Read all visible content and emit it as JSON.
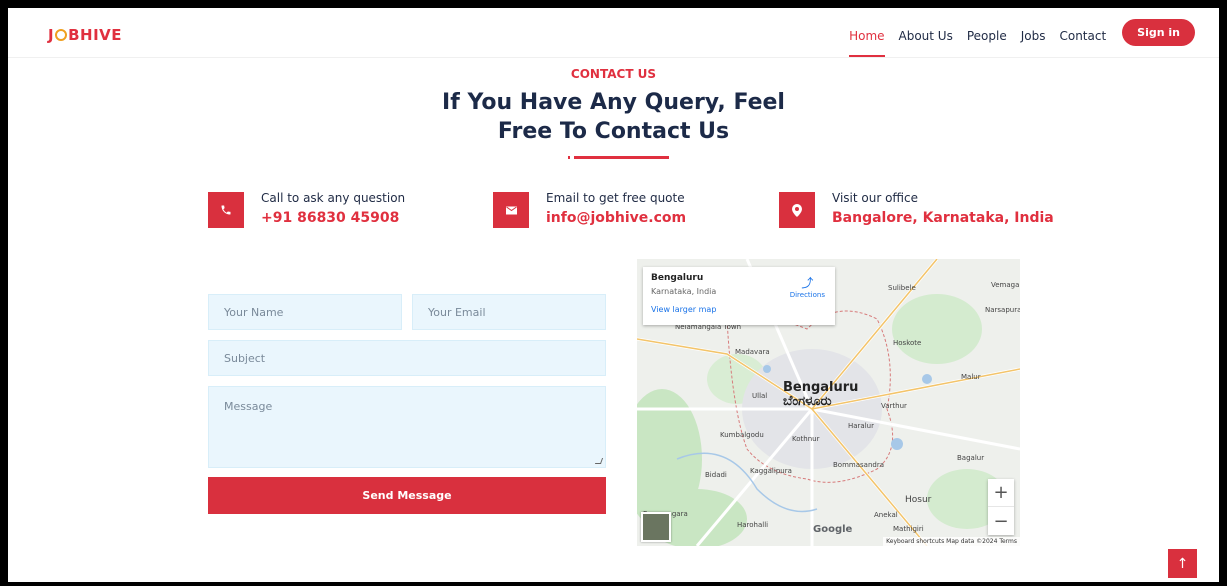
{
  "nav": {
    "logo": "JOBHIVE",
    "logo_left": "J",
    "logo_right": "BHIVE",
    "links": [
      "Home",
      "About Us",
      "People",
      "Jobs",
      "Contact"
    ],
    "signin": "Sign in"
  },
  "header": {
    "eyebrow": "CONTACT US",
    "title_line1": "If You Have Any Query, Feel",
    "title_line2": "Free To Contact Us"
  },
  "info": [
    {
      "label": "Call to ask any question",
      "value": "+91 86830 45908",
      "icon": "phone-icon"
    },
    {
      "label": "Email to get free quote",
      "value": "info@jobhive.com",
      "icon": "envelope-icon"
    },
    {
      "label": "Visit our office",
      "value": "Bangalore, Karnataka, India",
      "icon": "map-pin-icon"
    }
  ],
  "form": {
    "name_placeholder": "Your Name",
    "email_placeholder": "Your Email",
    "subject_placeholder": "Subject",
    "message_placeholder": "Message",
    "submit": "Send Message"
  },
  "map": {
    "place": "Bengaluru",
    "region": "Karnataka, India",
    "larger_map": "View larger map",
    "directions": "Directions",
    "city_en": "Bengaluru",
    "city_kn": "ಬೆಂಗಳೂರು",
    "labels": [
      "Nelamangala Town",
      "Madavara",
      "Ullal",
      "Kumbalgodu",
      "Kothnur",
      "Bidadi",
      "Kaggalipura",
      "Ramanagara",
      "Harohalli",
      "Sulibele",
      "Hoskote",
      "Varthur",
      "Haralur",
      "Malur",
      "Bommasandra",
      "Bagalur",
      "Hosur",
      "Anekal",
      "Mathigiri",
      "Vemagal",
      "Narsapura"
    ],
    "google": "Google",
    "attribution": "Keyboard shortcuts   Map data ©2024   Terms",
    "zoom_in": "+",
    "zoom_out": "−"
  },
  "totop": "↑",
  "colors": {
    "accent": "#d9303e",
    "heading": "#1c2a48",
    "field_bg": "#eaf6fd"
  }
}
